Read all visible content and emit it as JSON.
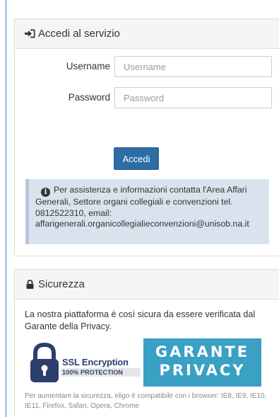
{
  "login_panel": {
    "title": "Accedi al servizio",
    "icon": "sign-in-icon",
    "username": {
      "label": "Username",
      "placeholder": "Username",
      "value": ""
    },
    "password": {
      "label": "Password",
      "placeholder": "Password",
      "value": ""
    },
    "submit_label": "Accedi",
    "info": {
      "icon": "info-circle-icon",
      "text": "Per assistenza e informazioni contatta l'Area Affari Generali, Settore organi collegiali e convenzioni tel. 0812522310, email:",
      "email": "affarigenerali.organicollegialieconvenzioni@unisob.na.it"
    }
  },
  "security_panel": {
    "title": "Sicurezza",
    "icon": "lock-icon",
    "description": "La nostra piattaforma è così sicura da essere verificata dal Garante della Privacy.",
    "ssl_badge": {
      "title": "SSL Encryption",
      "subtitle": "100% PROTECTION"
    },
    "garante_badge": {
      "line1": "GARANTE",
      "line2": "PRIVACY"
    },
    "browser_note": "Per aumentare la sicurezza, eligo è compatibile con i browser: IE8, IE9, IE10, IE11, Firefox, Safari, Opera, Chrome"
  },
  "colors": {
    "primary_button": "#2e6da4",
    "info_background": "#d9e3ee",
    "garante_background": "#3aa0c4",
    "ssl_text": "#2c3e6b"
  }
}
